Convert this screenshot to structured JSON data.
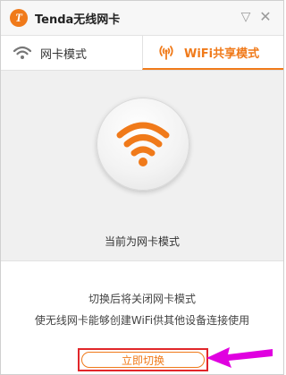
{
  "window": {
    "title": "Tenda无线网卡",
    "logo_letter": "T",
    "minimize_glyph": "▽",
    "close_glyph": "✕"
  },
  "tabs": [
    {
      "label": "网卡模式",
      "icon": "wifi-icon",
      "active": false
    },
    {
      "label": "WiFi共享模式",
      "icon": "hotspot-icon",
      "active": true
    }
  ],
  "main": {
    "big_icon": "wifi-signal-icon",
    "status_text": "当前为网卡模式"
  },
  "footer": {
    "line1": "切换后将关闭网卡模式",
    "line2": "使无线网卡能够创建WiFi供其他设备连接使用",
    "switch_button_label": "立即切换"
  },
  "colors": {
    "accent": "#f07a1a",
    "highlight_box": "#e1262a",
    "arrow": "#e000e0"
  }
}
